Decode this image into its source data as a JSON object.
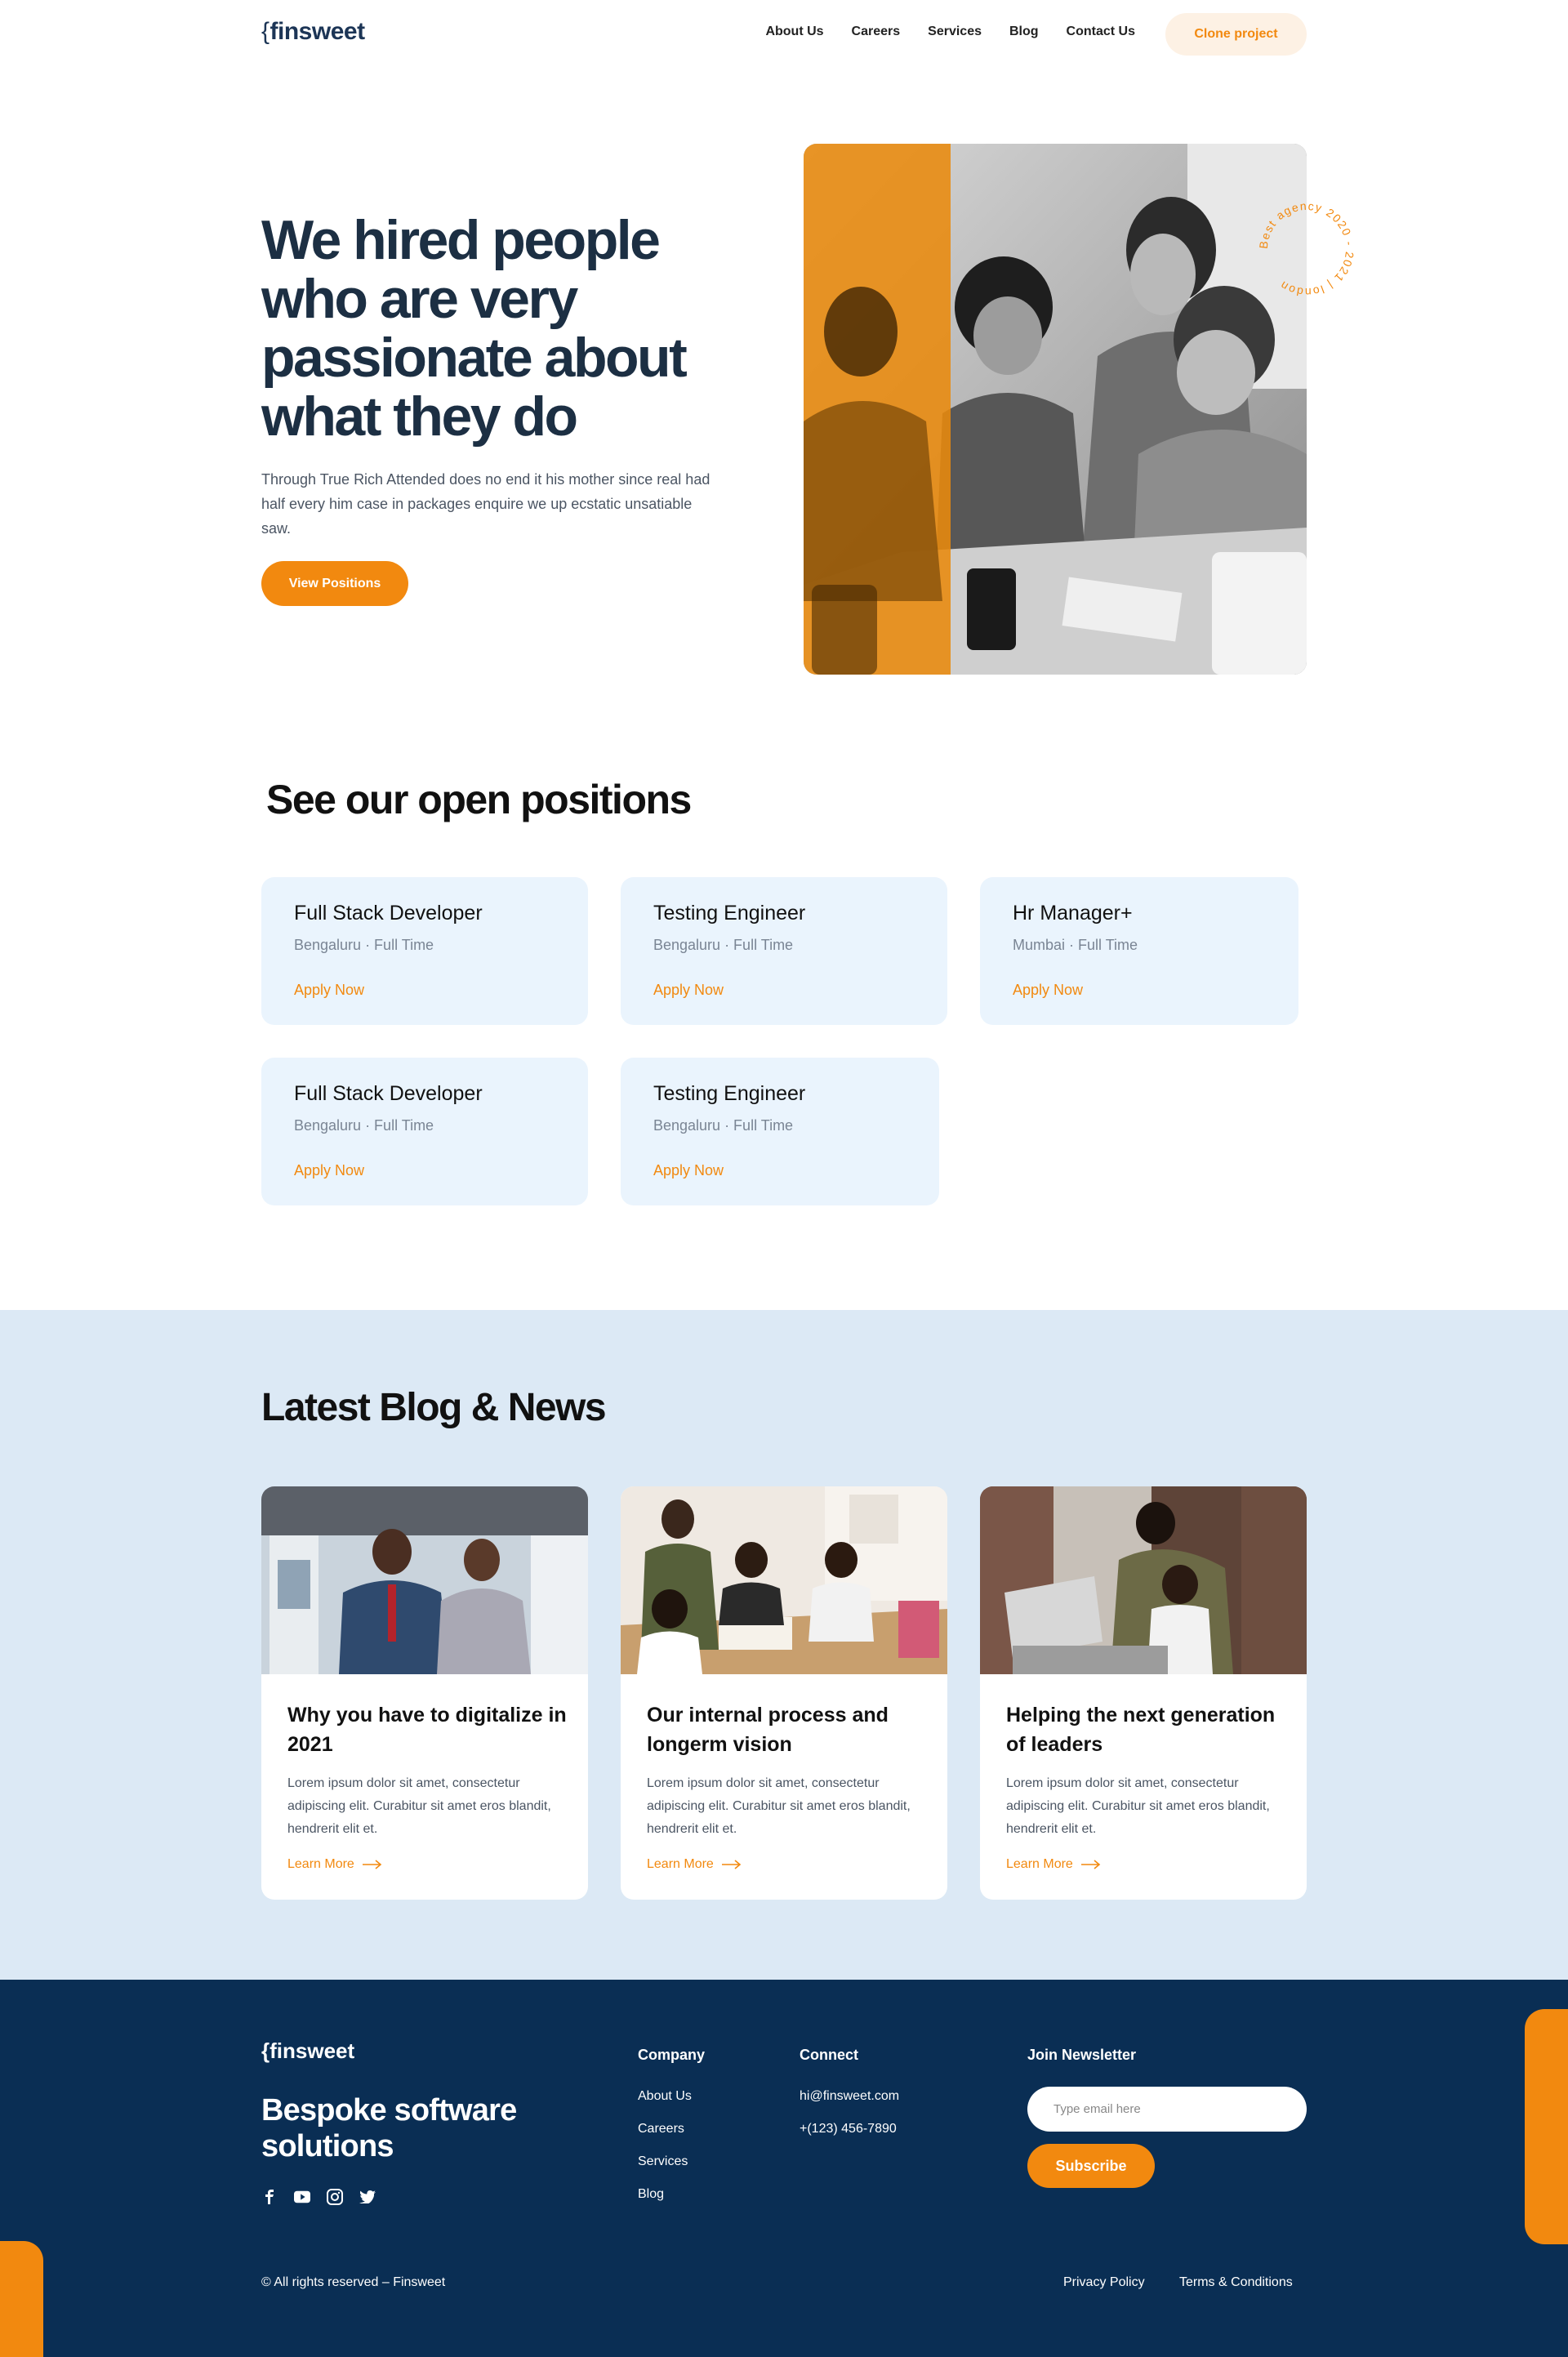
{
  "nav": {
    "logo_brace": "{",
    "logo_text": "finsweet",
    "links": [
      "About Us",
      "Careers",
      "Services",
      "Blog",
      "Contact Us"
    ],
    "cta": "Clone project"
  },
  "hero": {
    "title": "We hired people who are very passionate about what they do",
    "description": "Through True Rich Attended does no end it his mother since real had half every him case in packages enquire we up ecstatic unsatiable saw.",
    "button": "View Positions",
    "badge": "Best agency 2020 - 2021 | london",
    "accent_color": "#f2890f"
  },
  "positions": {
    "title": "See our open positions",
    "jobs": [
      {
        "title": "Full Stack Developer",
        "meta": "Bengaluru · Full Time",
        "action": "Apply Now"
      },
      {
        "title": "Testing Engineer",
        "meta": "Bengaluru · Full Time",
        "action": "Apply Now"
      },
      {
        "title": "Hr Manager+",
        "meta": "Mumbai · Full Time",
        "action": "Apply Now"
      },
      {
        "title": "Full Stack Developer",
        "meta": "Bengaluru · Full Time",
        "action": "Apply Now"
      },
      {
        "title": "Testing Engineer",
        "meta": "Bengaluru · Full Time",
        "action": "Apply Now"
      }
    ]
  },
  "blog": {
    "title": "Latest Blog & News",
    "posts": [
      {
        "title": "Why you have to digitalize in 2021",
        "excerpt": "Lorem ipsum dolor sit amet, consectetur adipiscing elit. Curabitur sit amet eros blandit, hendrerit elit et.",
        "link": "Learn More"
      },
      {
        "title": "Our internal process and longerm vision",
        "excerpt": "Lorem ipsum dolor sit amet, consectetur adipiscing elit. Curabitur sit amet eros blandit, hendrerit elit et.",
        "link": "Learn More"
      },
      {
        "title": "Helping the next generation of leaders",
        "excerpt": "Lorem ipsum dolor sit amet, consectetur adipiscing elit. Curabitur sit amet eros blandit, hendrerit elit et.",
        "link": "Learn More"
      }
    ]
  },
  "footer": {
    "logo_brace": "{",
    "logo_text": "finsweet",
    "tagline": "Bespoke software solutions",
    "social": [
      "facebook-icon",
      "youtube-icon",
      "instagram-icon",
      "twitter-icon"
    ],
    "company": {
      "heading": "Company",
      "links": [
        "About Us",
        "Careers",
        "Services",
        "Blog"
      ]
    },
    "connect": {
      "heading": "Connect",
      "email": "hi@finsweet.com",
      "phone": "+(123) 456-7890"
    },
    "newsletter": {
      "heading": "Join Newsletter",
      "placeholder": "Type email here",
      "button": "Subscribe"
    },
    "copyright": "© All rights reserved – Finsweet",
    "legal": [
      "Privacy Policy",
      "Terms & Conditions"
    ]
  },
  "colors": {
    "brand": "#f2890f",
    "navy": "#0a2e54",
    "card_bg": "#eaf4fd",
    "blog_bg": "#dce9f5"
  }
}
